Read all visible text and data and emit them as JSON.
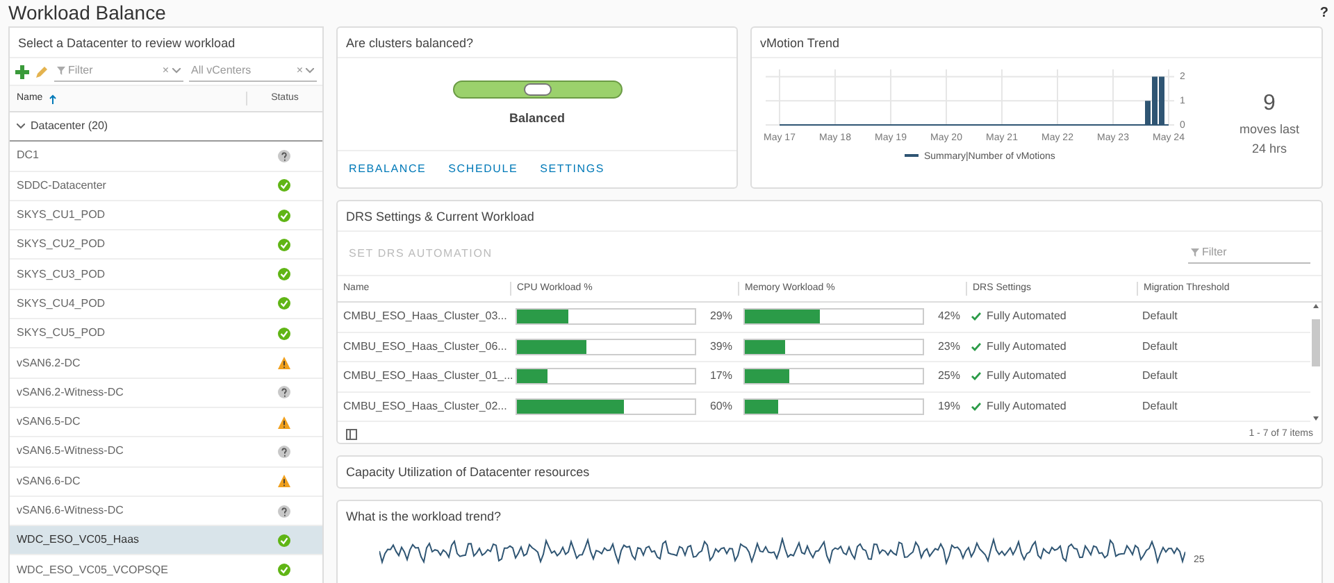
{
  "page": {
    "title": "Workload Balance",
    "help": "?"
  },
  "datacenters": {
    "title": "Select a Datacenter to review workload",
    "filter_placeholder": "Filter",
    "vcenter_placeholder": "All vCenters",
    "clear_glyph": "×",
    "columns": [
      {
        "label": "Name",
        "sorted": true
      },
      {
        "label": "Status",
        "sorted": false
      }
    ],
    "group": {
      "label": "Datacenter (20)",
      "expanded": true
    },
    "rows": [
      {
        "name": "DC1",
        "kind": "unknown",
        "selected": false
      },
      {
        "name": "SDDC-Datacenter",
        "kind": "ok",
        "selected": false
      },
      {
        "name": "SKYS_CU1_POD",
        "kind": "ok",
        "selected": false
      },
      {
        "name": "SKYS_CU2_POD",
        "kind": "ok",
        "selected": false
      },
      {
        "name": "SKYS_CU3_POD",
        "kind": "ok",
        "selected": false
      },
      {
        "name": "SKYS_CU4_POD",
        "kind": "ok",
        "selected": false
      },
      {
        "name": "SKYS_CU5_POD",
        "kind": "ok",
        "selected": false
      },
      {
        "name": "vSAN6.2-DC",
        "kind": "warning",
        "selected": false
      },
      {
        "name": "vSAN6.2-Witness-DC",
        "kind": "unknown",
        "selected": false
      },
      {
        "name": "vSAN6.5-DC",
        "kind": "warning",
        "selected": false
      },
      {
        "name": "vSAN6.5-Witness-DC",
        "kind": "unknown",
        "selected": false
      },
      {
        "name": "vSAN6.6-DC",
        "kind": "warning",
        "selected": false
      },
      {
        "name": "vSAN6.6-Witness-DC",
        "kind": "unknown",
        "selected": false
      },
      {
        "name": "WDC_ESO_VC05_Haas",
        "kind": "ok",
        "selected": true
      },
      {
        "name": "WDC_ESO_VC05_VCOPSQE",
        "kind": "ok",
        "selected": false
      }
    ]
  },
  "balance": {
    "title": "Are clusters balanced?",
    "level": 0.5,
    "label": "Balanced",
    "actions": [
      "REBALANCE",
      "SCHEDULE",
      "SETTINGS"
    ]
  },
  "vmotion": {
    "title": "vMotion Trend",
    "count": "9",
    "count_label": "moves last 24 hrs",
    "chart_data": {
      "type": "bar",
      "categories": [
        "May 17",
        null,
        null,
        null,
        null,
        null,
        null,
        null,
        "May 18",
        null,
        null,
        null,
        null,
        null,
        null,
        null,
        "May 19",
        null,
        null,
        null,
        null,
        null,
        null,
        null,
        "May 20",
        null,
        null,
        null,
        null,
        null,
        null,
        null,
        "May 21",
        null,
        null,
        null,
        null,
        null,
        null,
        null,
        "May 22",
        null,
        null,
        null,
        null,
        null,
        null,
        null,
        "May 23",
        null,
        null,
        null,
        null,
        null,
        null,
        null,
        "May 24"
      ],
      "series": [
        {
          "name": "Summary|Number of vMotions",
          "color": "#2f5573",
          "values": [
            0,
            0,
            0,
            0,
            0,
            0,
            0,
            0,
            0,
            0,
            0,
            0,
            0,
            0,
            0,
            0,
            0,
            0,
            0,
            0,
            0,
            0,
            0,
            0,
            0,
            0,
            0,
            0,
            0,
            0,
            0,
            0,
            0,
            0,
            0,
            0,
            0,
            0,
            0,
            0,
            0,
            0,
            0,
            0,
            0,
            0,
            0,
            0,
            0,
            0,
            0,
            0,
            0,
            1,
            2,
            2,
            0
          ]
        }
      ],
      "ylim": [
        0,
        2.3
      ],
      "grid": true,
      "yticks": [
        0,
        1,
        2
      ]
    }
  },
  "drs": {
    "title": "DRS Settings & Current Workload",
    "action": "SET DRS AUTOMATION",
    "action_disabled": true,
    "filter_placeholder": "Filter",
    "columns": [
      "Name",
      "CPU Workload %",
      "Memory Workload %",
      "DRS Settings",
      "Migration Threshold"
    ],
    "rows": [
      {
        "name": "CMBU_ESO_Haas_Cluster_03...",
        "cpu": {
          "level": 0.29,
          "reading": "29%"
        },
        "memory": {
          "level": 0.42,
          "reading": "42%"
        },
        "drs": "Fully Automated",
        "threshold": "Default"
      },
      {
        "name": "CMBU_ESO_Haas_Cluster_06...",
        "cpu": {
          "level": 0.39,
          "reading": "39%"
        },
        "memory": {
          "level": 0.23,
          "reading": "23%"
        },
        "drs": "Fully Automated",
        "threshold": "Default"
      },
      {
        "name": "CMBU_ESO_Haas_Cluster_01_...",
        "cpu": {
          "level": 0.17,
          "reading": "17%"
        },
        "memory": {
          "level": 0.25,
          "reading": "25%"
        },
        "drs": "Fully Automated",
        "threshold": "Default"
      },
      {
        "name": "CMBU_ESO_Haas_Cluster_02...",
        "cpu": {
          "level": 0.6,
          "reading": "60%"
        },
        "memory": {
          "level": 0.19,
          "reading": "19%"
        },
        "drs": "Fully Automated",
        "threshold": "Default"
      }
    ],
    "footer": "1 - 7 of 7 items"
  },
  "capacity": {
    "title": "Capacity Utilization of Datacenter resources"
  },
  "trend": {
    "title": "What is the workload trend?",
    "tick": "25"
  }
}
